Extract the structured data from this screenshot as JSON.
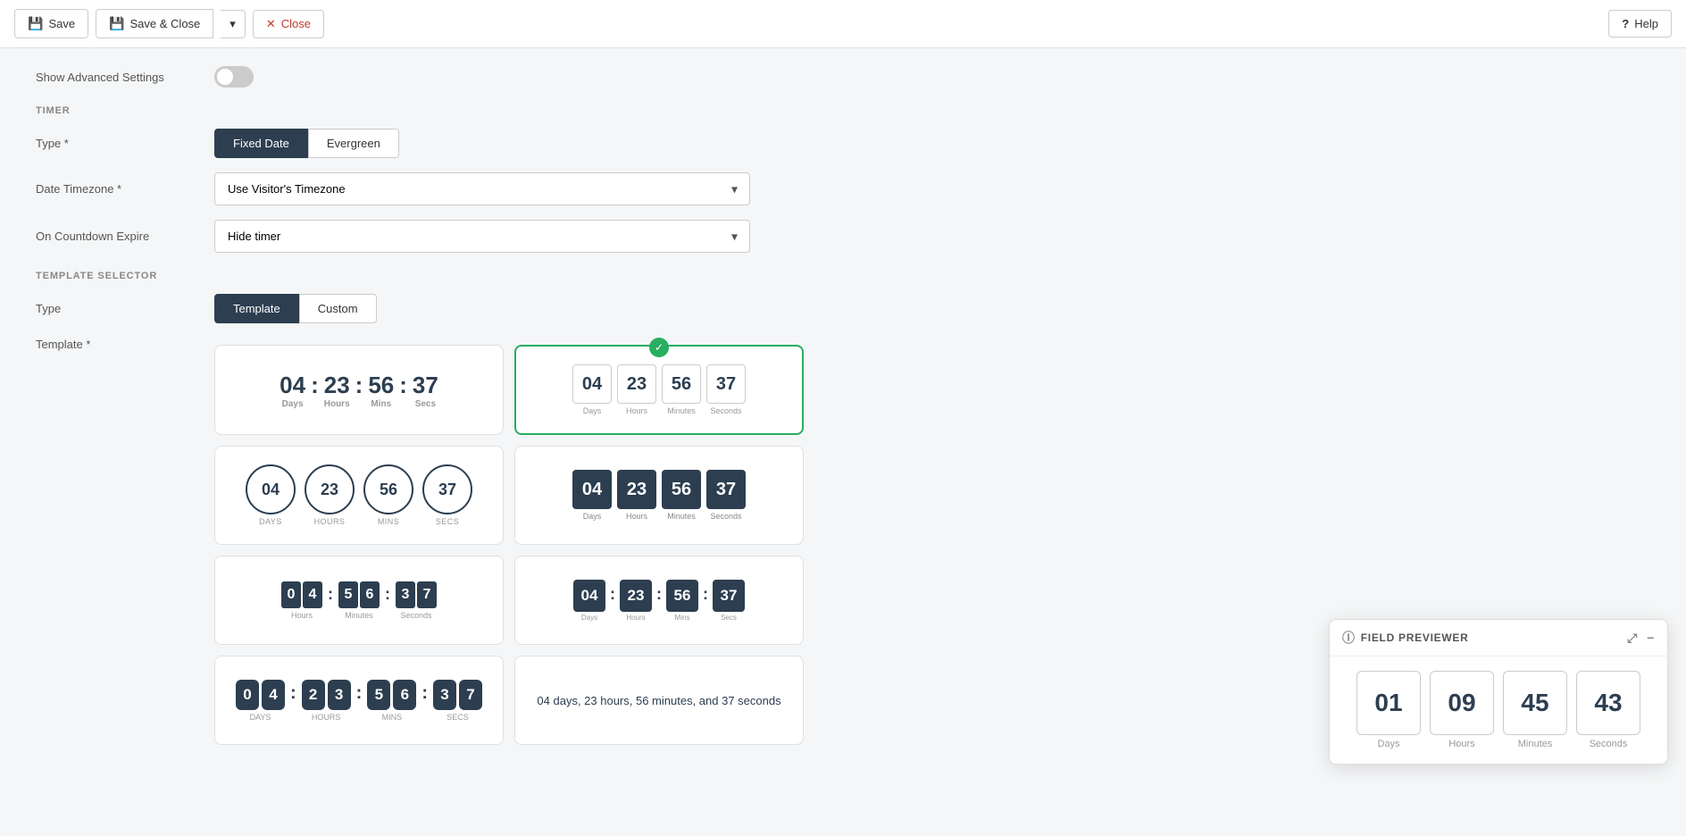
{
  "toolbar": {
    "save_label": "Save",
    "save_close_label": "Save & Close",
    "close_label": "Close",
    "help_label": "Help"
  },
  "settings": {
    "show_advanced_label": "Show Advanced Settings",
    "timer_section": "TIMER",
    "type_label": "Type *",
    "type_fixed": "Fixed Date",
    "type_evergreen": "Evergreen",
    "date_timezone_label": "Date Timezone *",
    "date_timezone_value": "Use Visitor's Timezone",
    "on_expire_label": "On Countdown Expire",
    "on_expire_value": "Hide timer",
    "template_section": "TEMPLATE SELECTOR",
    "template_type_label": "Type",
    "template_label_t": "Template",
    "template_label_c": "Custom",
    "template_label": "Template *"
  },
  "timer_values": {
    "days": "04",
    "hours": "23",
    "mins": "56",
    "secs": "37",
    "d1": "0",
    "d2": "4",
    "h1": "2",
    "h2": "3",
    "m1": "5",
    "m2": "6",
    "s1": "3",
    "s2": "7"
  },
  "templates": [
    {
      "id": "plain",
      "selected": false,
      "check": false
    },
    {
      "id": "box-light",
      "selected": true,
      "check": true
    },
    {
      "id": "circle-light",
      "selected": false,
      "check": false
    },
    {
      "id": "box-dark",
      "selected": false,
      "check": false
    },
    {
      "id": "flip-light",
      "selected": false,
      "check": false
    },
    {
      "id": "inline-dark",
      "selected": false,
      "check": false
    },
    {
      "id": "round-flip",
      "selected": false,
      "check": false
    },
    {
      "id": "text",
      "selected": false,
      "check": false
    }
  ],
  "field_previewer": {
    "title": "FIELD PREVIEWER",
    "days": "01",
    "hours": "09",
    "minutes": "45",
    "seconds": "43",
    "days_label": "Days",
    "hours_label": "Hours",
    "minutes_label": "Minutes",
    "seconds_label": "Seconds"
  },
  "text_timer_label": "04 days, 23 hours, 56 minutes, and 37 seconds"
}
